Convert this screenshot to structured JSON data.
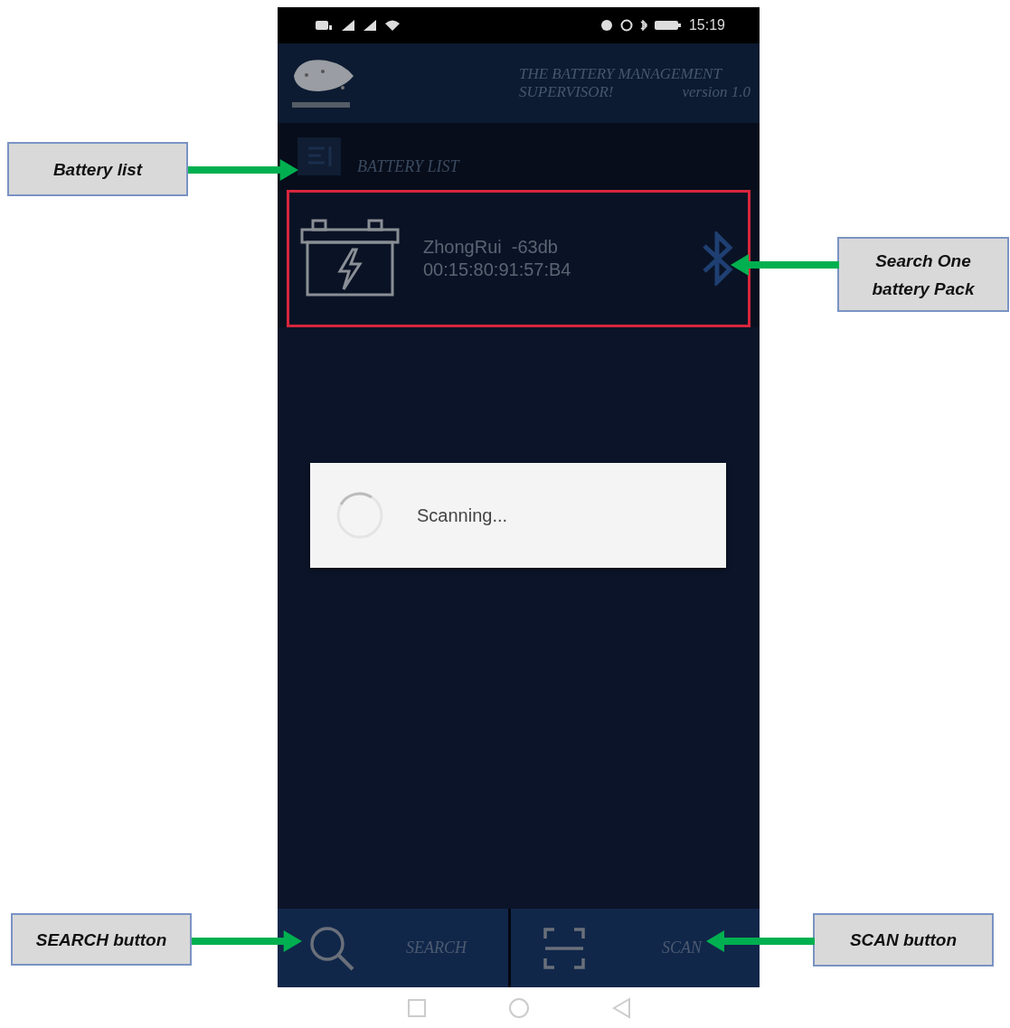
{
  "status_bar": {
    "time": "15:19"
  },
  "header": {
    "title_line_1": "THE BATTERY MANAGEMENT",
    "title_line_2": "SUPERVISOR!",
    "version": "version 1.0"
  },
  "section": {
    "title": "BATTERY LIST"
  },
  "devices": [
    {
      "name": "ZhongRui",
      "signal": "-63db",
      "address": "00:15:80:91:57:B4",
      "highlighted": true
    }
  ],
  "dialog": {
    "message": "Scanning..."
  },
  "bottom_tabs": [
    {
      "label": "SEARCH",
      "kind": "search"
    },
    {
      "label": "SCAN",
      "kind": "scan"
    }
  ],
  "annotations": [
    {
      "text": "Battery list",
      "kind": "rightward"
    },
    {
      "text": "Search One battery Pack",
      "kind": "leftward"
    },
    {
      "text": "SEARCH button",
      "kind": "rightward"
    },
    {
      "text": "SCAN button",
      "kind": "leftward"
    }
  ]
}
